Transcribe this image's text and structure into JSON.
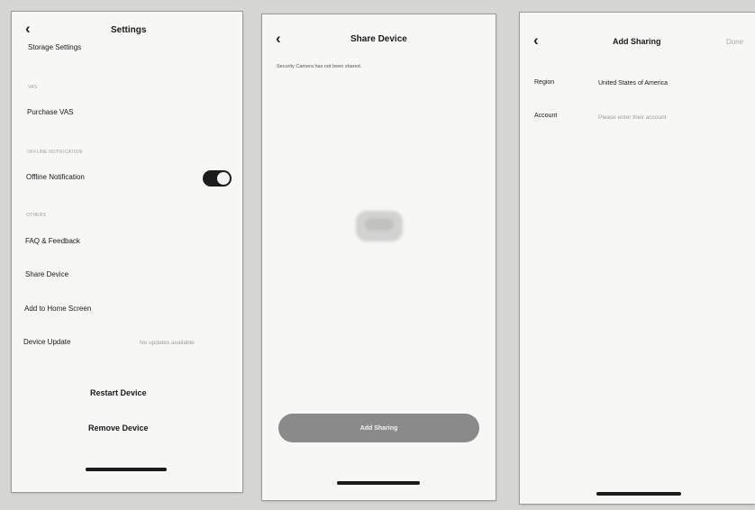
{
  "settings_screen": {
    "title": "Settings",
    "back_icon": "chevron-left-icon",
    "storage_settings": "Storage Settings",
    "section_vas": "VAS",
    "purchase_vas": "Purchase VAS",
    "section_offline": "OFFLINE NOTIFICATION",
    "offline_notification": "Offline Notification",
    "offline_notification_on": true,
    "section_others": "OTHERS",
    "faq_feedback": "FAQ & Feedback",
    "share_device": "Share Device",
    "add_to_home_screen": "Add to Home Screen",
    "device_update": "Device Update",
    "device_update_status": "No updates available",
    "restart_device": "Restart Device",
    "remove_device": "Remove Device"
  },
  "share_device_screen": {
    "title": "Share Device",
    "back_icon": "chevron-left-icon",
    "subtitle": "Security Camera has not been shared.",
    "empty_icon": "device-icon",
    "add_sharing_button": "Add Sharing"
  },
  "add_sharing_screen": {
    "title": "Add Sharing",
    "back_icon": "chevron-left-icon",
    "done_label": "Done",
    "region_label": "Region",
    "region_value": "United States of America",
    "account_label": "Account",
    "account_placeholder": "Please enter their account"
  }
}
